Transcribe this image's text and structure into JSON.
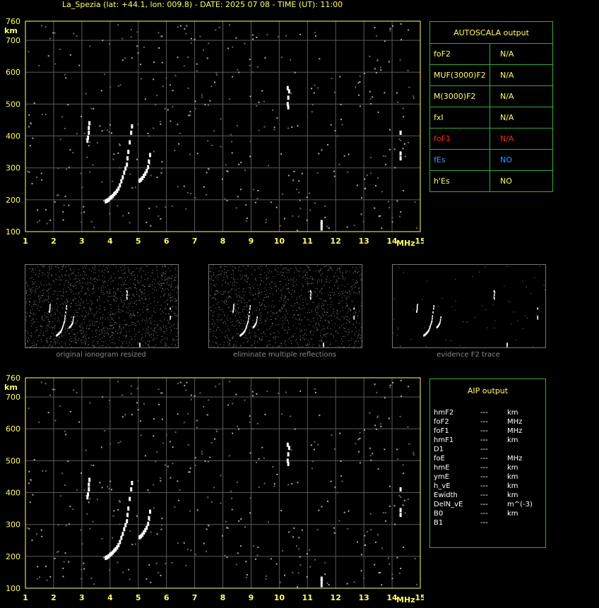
{
  "header": "La_Spezia (lat: +44.1, lon: 009.8) - DATE: 2025 07 08 - TIME (UT): 11:00",
  "autoscala": {
    "title": "AUTOSCALA output",
    "rows": [
      {
        "param": "foF2",
        "value": "N/A",
        "color": "#ffff66"
      },
      {
        "param": "MUF(3000)F2",
        "value": "N/A",
        "color": "#ffff66"
      },
      {
        "param": "M(3000)F2",
        "value": "N/A",
        "color": "#ffff66"
      },
      {
        "param": "fxI",
        "value": "N/A",
        "color": "#ffff66"
      },
      {
        "param": "foF1",
        "value": "N/A",
        "color": "#ff2222"
      },
      {
        "param": "fEs",
        "value": "NO",
        "color": "#3399ff"
      },
      {
        "param": "h'Es",
        "value": "NO",
        "color": "#ffff66"
      }
    ]
  },
  "thumbnails": [
    {
      "caption": "original ionogram resized"
    },
    {
      "caption": "eliminate multiple reflections"
    },
    {
      "caption": "evidence F2 trace"
    }
  ],
  "aip": {
    "title": "AIP output",
    "rows": [
      {
        "param": "hmF2",
        "value": "---",
        "unit": "km"
      },
      {
        "param": "foF2",
        "value": "---",
        "unit": "MHz"
      },
      {
        "param": "foF1",
        "value": "---",
        "unit": "MHz"
      },
      {
        "param": "hmF1",
        "value": "---",
        "unit": "km"
      },
      {
        "param": "D1",
        "value": "---",
        "unit": ""
      },
      {
        "param": "foE",
        "value": "---",
        "unit": "MHz"
      },
      {
        "param": "hmE",
        "value": "---",
        "unit": "km"
      },
      {
        "param": "ymE",
        "value": "---",
        "unit": "km"
      },
      {
        "param": "h_vE",
        "value": "---",
        "unit": "km"
      },
      {
        "param": "Ewidth",
        "value": "---",
        "unit": "km"
      },
      {
        "param": "DelN_vE",
        "value": "---",
        "unit": "m^(-3)"
      },
      {
        "param": "B0",
        "value": "---",
        "unit": "km"
      },
      {
        "param": "B1",
        "value": "---",
        "unit": ""
      }
    ]
  },
  "chart_data": [
    {
      "type": "scatter",
      "title": "",
      "xlabel": "MHz",
      "ylabel": "km",
      "xlim": [
        1,
        15
      ],
      "ylim": [
        100,
        760
      ],
      "xticks": [
        1,
        2,
        3,
        4,
        5,
        6,
        7,
        8,
        9,
        10,
        11,
        12,
        13,
        14,
        15
      ],
      "yticks": [
        100,
        200,
        300,
        400,
        500,
        600,
        700,
        760
      ],
      "grid": true,
      "series": [
        {
          "points": [
            [
              3.85,
              195
            ],
            [
              3.9,
              197
            ],
            [
              3.95,
              200
            ],
            [
              4.0,
              205
            ],
            [
              4.05,
              208
            ],
            [
              4.1,
              212
            ],
            [
              4.15,
              218
            ],
            [
              4.2,
              222
            ],
            [
              4.25,
              228
            ],
            [
              4.3,
              235
            ],
            [
              4.35,
              245
            ],
            [
              4.4,
              258
            ],
            [
              4.45,
              270
            ],
            [
              4.5,
              285
            ],
            [
              4.55,
              298
            ],
            [
              4.6,
              310
            ],
            [
              4.62,
              330
            ],
            [
              4.65,
              350
            ],
            [
              4.7,
              380
            ],
            [
              4.75,
              410
            ],
            [
              4.78,
              430
            ],
            [
              5.05,
              260
            ],
            [
              5.1,
              263
            ],
            [
              5.15,
              268
            ],
            [
              5.2,
              275
            ],
            [
              5.25,
              282
            ],
            [
              5.3,
              290
            ],
            [
              5.35,
              302
            ],
            [
              5.38,
              320
            ],
            [
              5.42,
              340
            ],
            [
              3.2,
              385
            ],
            [
              3.22,
              395
            ],
            [
              3.25,
              410
            ],
            [
              3.25,
              425
            ],
            [
              3.27,
              440
            ],
            [
              10.3,
              500
            ],
            [
              10.32,
              520
            ],
            [
              10.35,
              540
            ],
            [
              10.3,
              550
            ],
            [
              10.32,
              490
            ],
            [
              11.5,
              110
            ],
            [
              11.5,
              122
            ],
            [
              11.5,
              130
            ],
            [
              14.3,
              330
            ],
            [
              14.3,
              345
            ],
            [
              14.3,
              410
            ]
          ]
        }
      ]
    },
    {
      "type": "scatter",
      "title": "",
      "xlabel": "MHz",
      "ylabel": "km",
      "xlim": [
        1,
        15
      ],
      "ylim": [
        100,
        760
      ],
      "xticks": [
        1,
        2,
        3,
        4,
        5,
        6,
        7,
        8,
        9,
        10,
        11,
        12,
        13,
        14,
        15
      ],
      "yticks": [
        100,
        200,
        300,
        400,
        500,
        600,
        700,
        760
      ],
      "grid": true,
      "series": [
        {
          "points": [
            [
              3.85,
              195
            ],
            [
              3.9,
              197
            ],
            [
              3.95,
              200
            ],
            [
              4.0,
              205
            ],
            [
              4.05,
              208
            ],
            [
              4.1,
              212
            ],
            [
              4.15,
              218
            ],
            [
              4.2,
              222
            ],
            [
              4.25,
              228
            ],
            [
              4.3,
              235
            ],
            [
              4.35,
              245
            ],
            [
              4.4,
              258
            ],
            [
              4.45,
              270
            ],
            [
              4.5,
              285
            ],
            [
              4.55,
              298
            ],
            [
              4.6,
              310
            ],
            [
              4.62,
              330
            ],
            [
              4.65,
              350
            ],
            [
              4.7,
              380
            ],
            [
              4.75,
              410
            ],
            [
              4.78,
              430
            ],
            [
              5.05,
              260
            ],
            [
              5.1,
              263
            ],
            [
              5.15,
              268
            ],
            [
              5.2,
              275
            ],
            [
              5.25,
              282
            ],
            [
              5.3,
              290
            ],
            [
              5.35,
              302
            ],
            [
              5.38,
              320
            ],
            [
              5.42,
              340
            ],
            [
              3.2,
              385
            ],
            [
              3.22,
              395
            ],
            [
              3.25,
              410
            ],
            [
              3.25,
              425
            ],
            [
              3.27,
              440
            ],
            [
              10.3,
              500
            ],
            [
              10.32,
              520
            ],
            [
              10.35,
              540
            ],
            [
              10.3,
              550
            ],
            [
              10.32,
              490
            ],
            [
              11.5,
              110
            ],
            [
              11.5,
              122
            ],
            [
              11.5,
              130
            ],
            [
              14.3,
              330
            ],
            [
              14.3,
              345
            ],
            [
              14.3,
              410
            ]
          ]
        }
      ]
    }
  ]
}
